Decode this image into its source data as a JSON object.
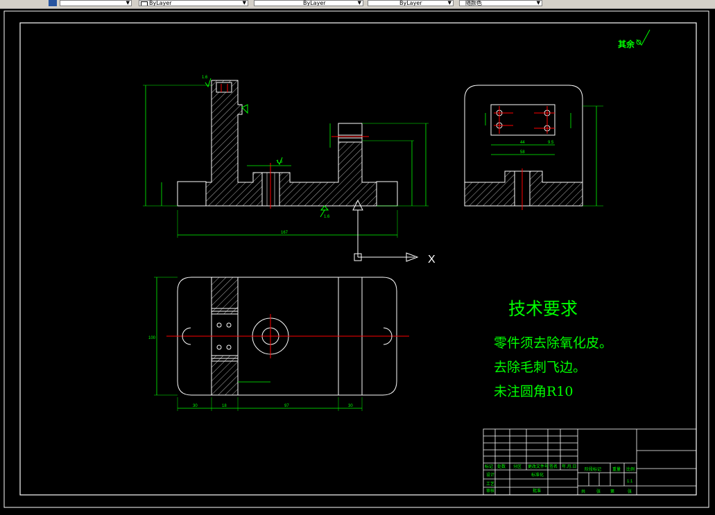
{
  "toolbar": {
    "combo_1": "",
    "combo_2": "ByLayer",
    "combo_3": "ByLayer",
    "combo_4": "ByLayer",
    "combo_5": "随颜色"
  },
  "drawing": {
    "roughness_note": "其余",
    "tech_title": "技术要求",
    "tech_items": [
      "零件须去除氧化皮。",
      "去除毛刺飞边。",
      "未注圆角R10"
    ],
    "ucs_x_label": "X",
    "front_overall_dim": "167",
    "bottom_dims": [
      "30",
      "18",
      "97",
      "30"
    ],
    "bottom_height_dim": "100",
    "side_dims": [
      "44",
      "58",
      "9.5"
    ],
    "roughness_values": [
      "1.6",
      "1.6",
      "1.6"
    ],
    "colors": {
      "green": "#00ff00",
      "white": "#ffffff",
      "red": "#ff0000",
      "line": "#ffffff"
    }
  },
  "title_block": {
    "header_row": [
      "标记",
      "处数",
      "分区",
      "更改文件号",
      "签名",
      "年.月.日"
    ],
    "labels": [
      "设计",
      "标准化",
      "审核",
      "工艺",
      "批准"
    ],
    "stage_labels": [
      "阶段标记",
      "重量",
      "比例"
    ],
    "scale": "1:1",
    "sheet_row": [
      "共",
      "张",
      "第",
      "张"
    ]
  }
}
